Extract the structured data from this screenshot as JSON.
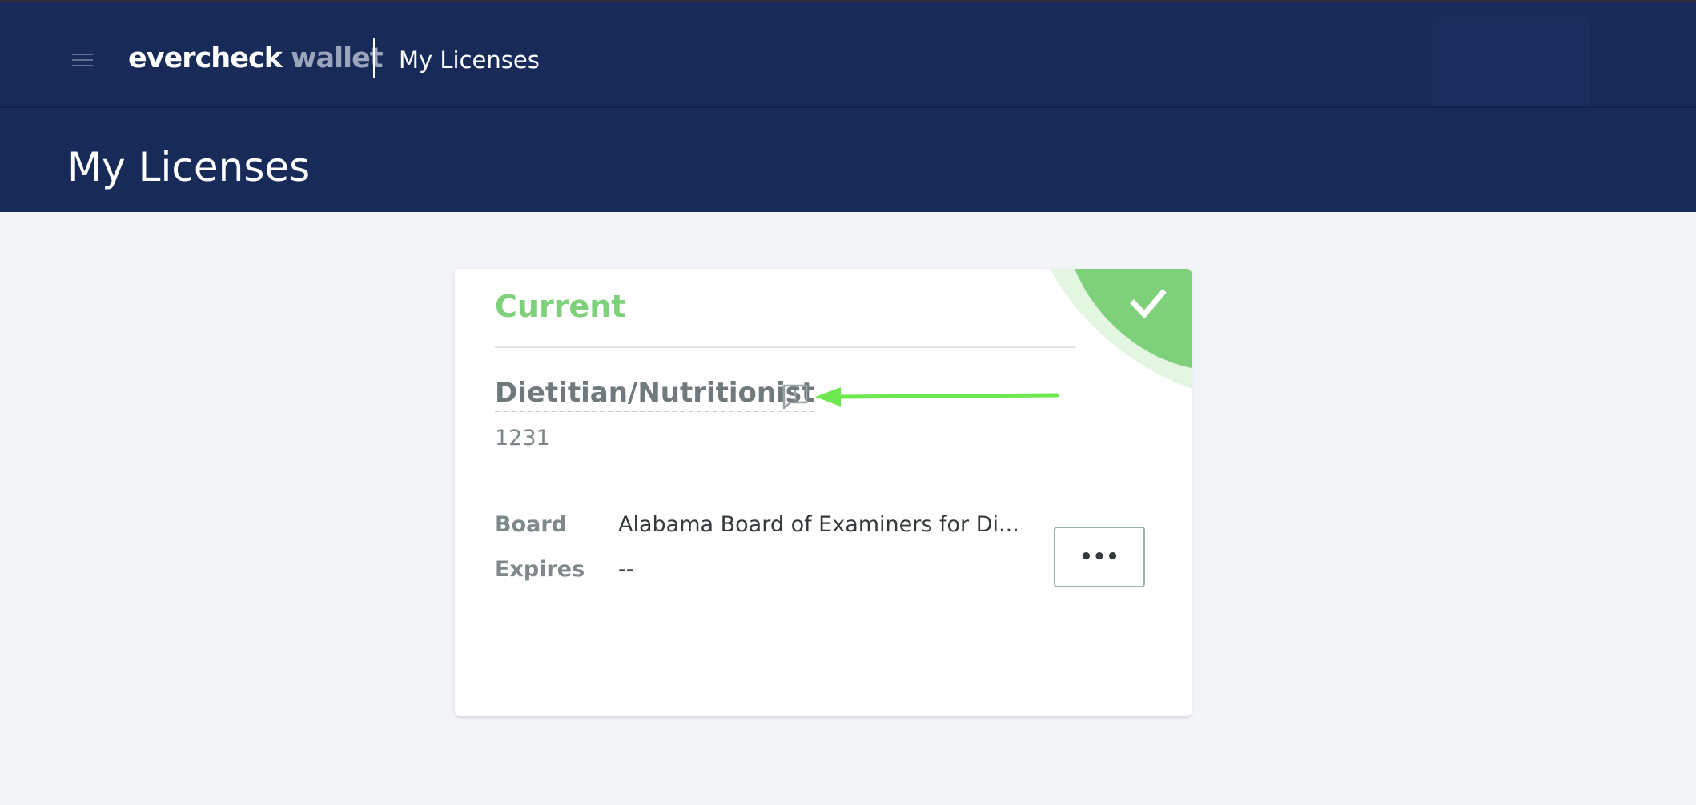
{
  "topbar": {
    "brand_primary": "evercheck",
    "brand_secondary": "wallet",
    "section_title": "My Licenses",
    "menu_icon": "hamburger-menu-icon"
  },
  "page": {
    "title": "My Licenses"
  },
  "license_card": {
    "status": "Current",
    "status_icon": "checkmark-icon",
    "name": "Dietitian/Nutritionist",
    "note_icon": "comment-alert-icon",
    "number": "1231",
    "fields": [
      {
        "label": "Board",
        "value": "Alabama Board of Examiners for Di..."
      },
      {
        "label": "Expires",
        "value": "--"
      }
    ],
    "more_button_label": "•••"
  },
  "annotation": {
    "arrow_icon": "green-arrow-pointer",
    "color": "#6ee84f"
  },
  "colors": {
    "header_bg": "#172a58",
    "page_bg": "#f2f4f8",
    "status_green": "#7fd07b",
    "status_green_light": "#e3f6e1"
  }
}
